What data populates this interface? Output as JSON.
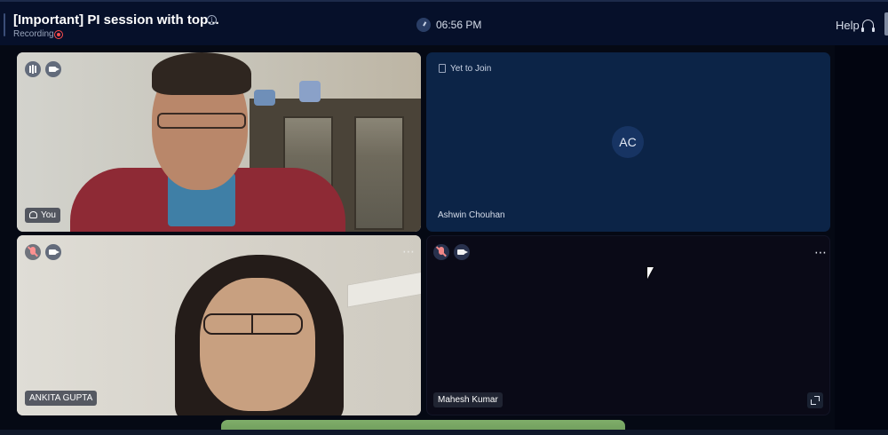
{
  "header": {
    "title": "[Important] PI session with top...",
    "recording_label": "Recording",
    "clock_time": "06:56 PM",
    "help_label": "Help"
  },
  "tiles": [
    {
      "name": "You",
      "video": true,
      "speaking": true
    },
    {
      "name": "Ashwin Chouhan",
      "status": "Yet to Join",
      "initials": "AC"
    },
    {
      "name": "ANKITA GUPTA",
      "video": true,
      "mic_muted": true
    },
    {
      "name": "Mahesh Kumar",
      "video": false,
      "mic_muted": true
    }
  ],
  "icons": {
    "more": "⋯"
  },
  "colors": {
    "topbar": "#06102a",
    "tile_dark": "#0c2447",
    "recording": "#ff4d4d",
    "avatar": "#173463"
  }
}
